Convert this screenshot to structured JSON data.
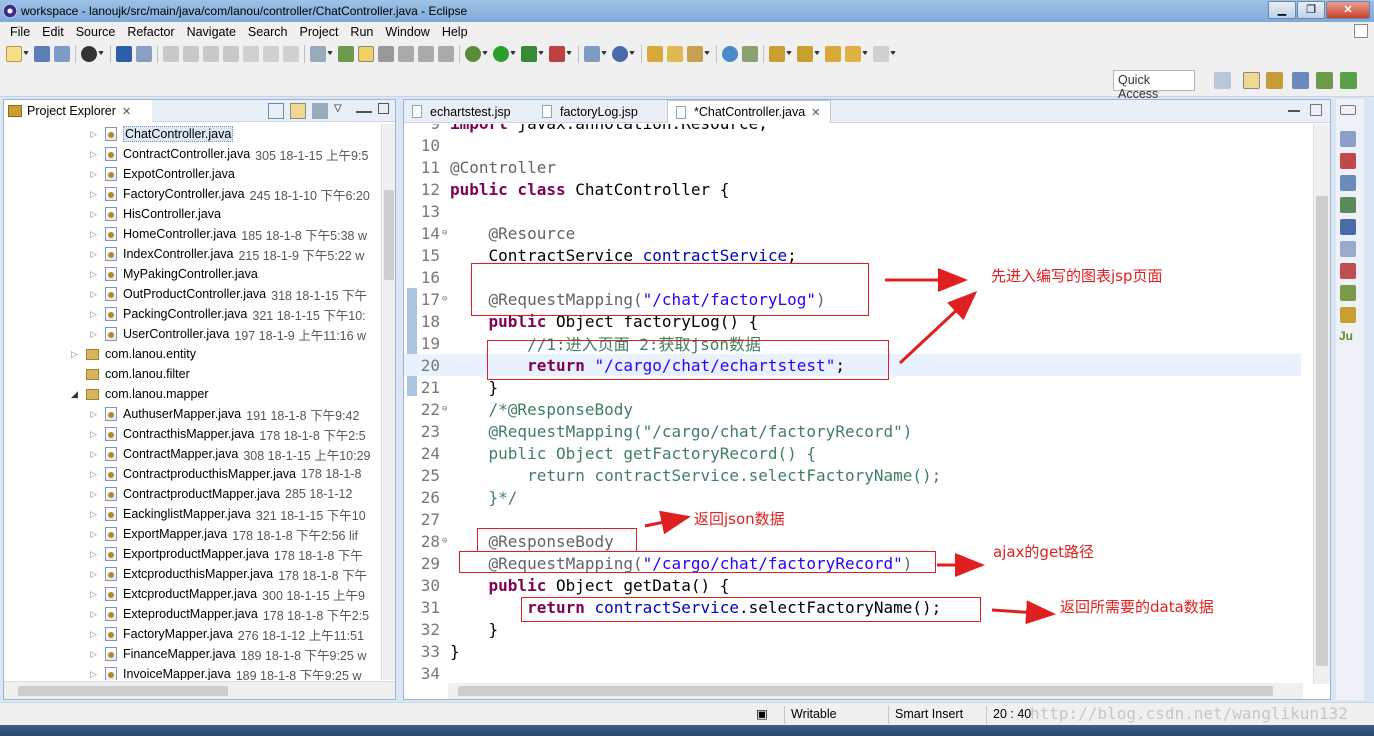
{
  "window": {
    "title": "workspace - lanoujk/src/main/java/com/lanou/controller/ChatController.java - Eclipse"
  },
  "menu": [
    "File",
    "Edit",
    "Source",
    "Refactor",
    "Navigate",
    "Search",
    "Project",
    "Run",
    "Window",
    "Help"
  ],
  "toolbar": {
    "quick_access": "Quick Access"
  },
  "explorer": {
    "title": "Project Explorer",
    "close": "✕",
    "items": [
      {
        "name": "ChatController.java",
        "meta": ""
      },
      {
        "name": "ContractController.java",
        "meta": "305  18-1-15 上午9:5"
      },
      {
        "name": "ExpotController.java",
        "meta": ""
      },
      {
        "name": "FactoryController.java",
        "meta": "245  18-1-10 下午6:20"
      },
      {
        "name": "HisController.java",
        "meta": ""
      },
      {
        "name": "HomeController.java",
        "meta": "185  18-1-8 下午5:38  w"
      },
      {
        "name": "IndexController.java",
        "meta": "215  18-1-9 下午5:22  w"
      },
      {
        "name": "MyPakingController.java",
        "meta": ""
      },
      {
        "name": "OutProductController.java",
        "meta": "318  18-1-15 下午"
      },
      {
        "name": "PackingController.java",
        "meta": "321  18-1-15 下午10:"
      },
      {
        "name": "UserController.java",
        "meta": "197  18-1-9 上午11:16  w"
      },
      {
        "name": "com.lanou.entity",
        "meta": ""
      },
      {
        "name": "com.lanou.filter",
        "meta": ""
      },
      {
        "name": "com.lanou.mapper",
        "meta": ""
      },
      {
        "name": "AuthuserMapper.java",
        "meta": "191  18-1-8 下午9:42"
      },
      {
        "name": "ContracthisMapper.java",
        "meta": "178  18-1-8 下午2:5"
      },
      {
        "name": "ContractMapper.java",
        "meta": "308  18-1-15 上午10:29"
      },
      {
        "name": "ContractproducthisMapper.java",
        "meta": "178  18-1-8"
      },
      {
        "name": "ContractproductMapper.java",
        "meta": "285  18-1-12"
      },
      {
        "name": "EackinglistMapper.java",
        "meta": "321  18-1-15 下午10"
      },
      {
        "name": "ExportMapper.java",
        "meta": "178  18-1-8 下午2:56  lif"
      },
      {
        "name": "ExportproductMapper.java",
        "meta": "178  18-1-8 下午"
      },
      {
        "name": "ExtcproducthisMapper.java",
        "meta": "178  18-1-8 下午"
      },
      {
        "name": "ExtcproductMapper.java",
        "meta": "300  18-1-15 上午9"
      },
      {
        "name": "ExteproductMapper.java",
        "meta": "178  18-1-8 下午2:5"
      },
      {
        "name": "FactoryMapper.java",
        "meta": "276  18-1-12 上午11:51"
      },
      {
        "name": "FinanceMapper.java",
        "meta": "189  18-1-8 下午9:25  w"
      },
      {
        "name": "InvoiceMapper.java",
        "meta": "189  18-1-8 下午9:25  w"
      }
    ]
  },
  "editor": {
    "tabs": [
      {
        "label": "echartstest.jsp"
      },
      {
        "label": "factoryLog.jsp"
      },
      {
        "label": "*ChatController.java",
        "close": "✕"
      }
    ],
    "lines": [
      {
        "n": "9",
        "parts": [
          [
            "kw",
            "import"
          ],
          [
            "code",
            " javax.annotation.Resource;"
          ]
        ]
      },
      {
        "n": "10",
        "parts": []
      },
      {
        "n": "11",
        "parts": [
          [
            "ann",
            "@Controller"
          ]
        ]
      },
      {
        "n": "12",
        "parts": [
          [
            "kw",
            "public class"
          ],
          [
            "code",
            " ChatController {"
          ]
        ]
      },
      {
        "n": "13",
        "parts": []
      },
      {
        "n": "14",
        "parts": [
          [
            "code",
            "    "
          ],
          [
            "ann",
            "@Resource"
          ]
        ]
      },
      {
        "n": "15",
        "parts": [
          [
            "code",
            "    ContractService "
          ],
          [
            "fld",
            "contractService"
          ],
          [
            "code",
            ";"
          ]
        ]
      },
      {
        "n": "16",
        "parts": []
      },
      {
        "n": "17",
        "parts": [
          [
            "code",
            "    "
          ],
          [
            "ann",
            "@RequestMapping("
          ],
          [
            "str",
            "\"/chat/factoryLog\""
          ],
          [
            "ann",
            ")"
          ]
        ]
      },
      {
        "n": "18",
        "parts": [
          [
            "code",
            "    "
          ],
          [
            "kw",
            "public"
          ],
          [
            "code",
            " Object factoryLog() {"
          ]
        ]
      },
      {
        "n": "19",
        "parts": [
          [
            "code",
            "        "
          ],
          [
            "cmt",
            "//1:进入页面 2:获取json数据"
          ]
        ]
      },
      {
        "n": "20",
        "parts": [
          [
            "code",
            "        "
          ],
          [
            "kw",
            "return"
          ],
          [
            "code",
            " "
          ],
          [
            "str",
            "\"/cargo/chat/echartstest\""
          ],
          [
            "code",
            ";"
          ]
        ]
      },
      {
        "n": "21",
        "parts": [
          [
            "code",
            "    }"
          ]
        ]
      },
      {
        "n": "22",
        "parts": [
          [
            "code",
            "    "
          ],
          [
            "cmt",
            "/*@ResponseBody"
          ]
        ]
      },
      {
        "n": "23",
        "parts": [
          [
            "cmt",
            "    @RequestMapping(\"/cargo/chat/factoryRecord\")"
          ]
        ]
      },
      {
        "n": "24",
        "parts": [
          [
            "cmt",
            "    public Object getFactoryRecord() {"
          ]
        ]
      },
      {
        "n": "25",
        "parts": [
          [
            "cmt",
            "        return contractService.selectFactoryName();"
          ]
        ]
      },
      {
        "n": "26",
        "parts": [
          [
            "cmt",
            "    }*/"
          ]
        ]
      },
      {
        "n": "27",
        "parts": []
      },
      {
        "n": "28",
        "parts": [
          [
            "code",
            "    "
          ],
          [
            "ann",
            "@ResponseBody"
          ]
        ]
      },
      {
        "n": "29",
        "parts": [
          [
            "code",
            "    "
          ],
          [
            "ann",
            "@RequestMapping("
          ],
          [
            "str",
            "\"/cargo/chat/factoryRecord\""
          ],
          [
            "ann",
            ")"
          ]
        ]
      },
      {
        "n": "30",
        "parts": [
          [
            "code",
            "    "
          ],
          [
            "kw",
            "public"
          ],
          [
            "code",
            " Object getData() {"
          ]
        ]
      },
      {
        "n": "31",
        "parts": [
          [
            "code",
            "        "
          ],
          [
            "kw",
            "return"
          ],
          [
            "code",
            " "
          ],
          [
            "fld",
            "contractService"
          ],
          [
            "code",
            ".selectFactoryName();"
          ]
        ]
      },
      {
        "n": "32",
        "parts": [
          [
            "code",
            "    }"
          ]
        ]
      },
      {
        "n": "33",
        "parts": [
          [
            "code",
            "}"
          ]
        ]
      },
      {
        "n": "34",
        "parts": []
      }
    ]
  },
  "annotations": {
    "a1": "先进入编写的图表jsp页面",
    "a2": "返回json数据",
    "a3": "ajax的get路径",
    "a4": "返回所需要的data数据"
  },
  "status": {
    "writable": "Writable",
    "insert": "Smart Insert",
    "position": "20 : 40"
  },
  "watermark": "http://blog.csdn.net/wanglikun132",
  "colors": {
    "annotation_red": "#e02020",
    "keyword": "#7f0055",
    "string": "#2a00ff",
    "comment": "#3f7f5f",
    "field": "#0000c0"
  }
}
